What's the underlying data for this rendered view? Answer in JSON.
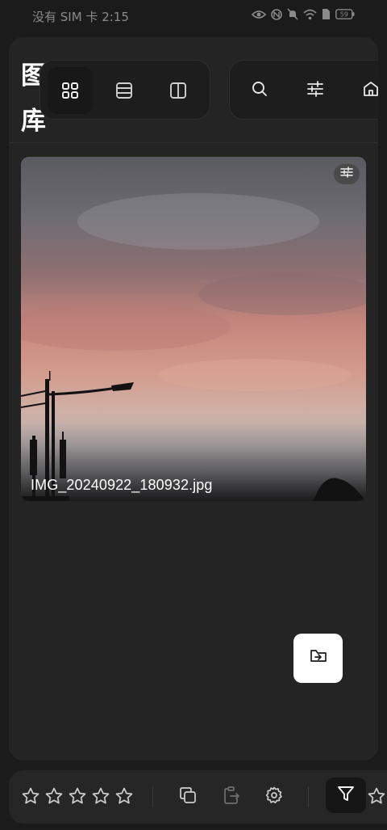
{
  "status_bar": {
    "text": "没有 SIM 卡 2:15",
    "icons": [
      "eye-icon",
      "nfc-icon",
      "mute-icon",
      "wifi-icon",
      "sim-icon",
      "battery-icon"
    ],
    "battery_level": "59"
  },
  "header": {
    "title": "图库",
    "view_modes": [
      "grid-view-icon",
      "list-view-icon",
      "split-view-icon"
    ],
    "active_view": "grid",
    "actions": [
      "search-icon",
      "adjust-icon",
      "home-icon"
    ]
  },
  "gallery": {
    "items": [
      {
        "filename": "IMG_20240922_180932.jpg"
      }
    ]
  },
  "bottom_bar": {
    "rating_stars": 5,
    "rating_value": 0,
    "actions": [
      "copy-icon",
      "move-to-icon",
      "settings-icon",
      "filter-icon",
      "star-icon"
    ]
  },
  "colors": {
    "background": "#1b1b1b",
    "panel": "#242424",
    "accent": "#ffffff"
  }
}
